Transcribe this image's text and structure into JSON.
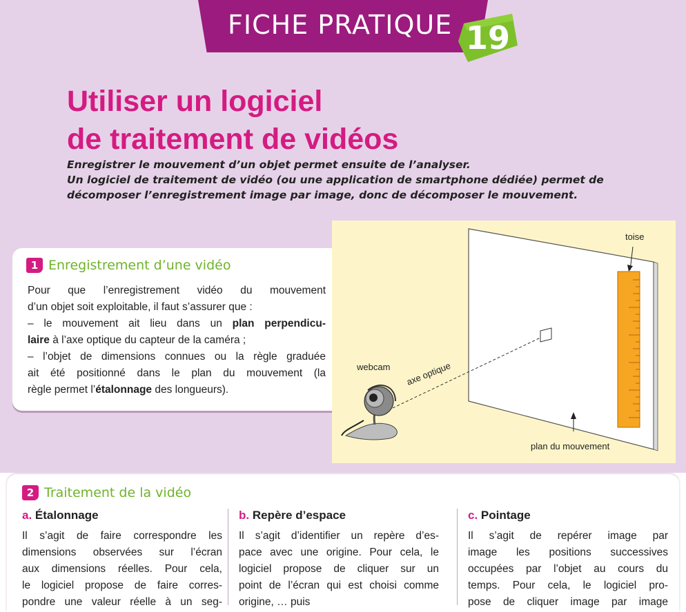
{
  "header": {
    "banner_title": "FICHE PRATIQUE",
    "number": "19",
    "banner_color": "#9c1b7e",
    "badge_color": "#7dc02c"
  },
  "title": {
    "line1": "Utiliser un logiciel",
    "line2": "de traitement de vidéos",
    "color": "#d41b82"
  },
  "intro": {
    "line1": "Enregistrer le mouvement d’un objet permet ensuite de l’analyser.",
    "line2": "Un logiciel de traitement de vidéo (ou une application de smartphone dédiée) permet de",
    "line3": "décomposer l’enregistrement image par image, donc de décomposer le mouvement."
  },
  "section1": {
    "number": "1",
    "title": "Enregistrement d’une vidéo",
    "lines": {
      "l1": "Pour que l’enregistrement vidéo du mouvement",
      "l2": "d’un objet soit exploitable, il faut s’assurer que :",
      "l3a": "– le mouvement ait lieu dans un ",
      "l3b": "plan perpendicu-",
      "l4a": "laire",
      "l4b": " à l’axe optique du capteur de la caméra ;",
      "l5": "– l’objet de dimensions connues ou la règle graduée",
      "l6": "ait été positionné dans le plan du mouvement (la",
      "l7a": "règle permet l’",
      "l7b": "étalonnage",
      "l7c": " des longueurs)."
    }
  },
  "diagram": {
    "label_toise": "toise",
    "label_webcam": "webcam",
    "label_axe": "axe optique",
    "label_plan": "plan du mouvement"
  },
  "section2": {
    "number": "2",
    "title": "Traitement de la vidéo",
    "columns": [
      {
        "letter": "a.",
        "heading": "Étalonnage",
        "lines": [
          "Il s’agit de faire correspondre les",
          "dimensions observées sur l’écran",
          "aux dimensions réelles. Pour cela,",
          "le logiciel propose de faire corres-",
          "pondre une valeur réelle à un seg-"
        ]
      },
      {
        "letter": "b.",
        "heading": "Repère d’espace",
        "lines": [
          "Il s’agit d’identifier un repère d’es-",
          "pace avec une origine. Pour cela, le",
          "logiciel propose de cliquer sur un",
          "point de l’écran qui est choisi comme",
          "origine, … puis"
        ]
      },
      {
        "letter": "c.",
        "heading": "Pointage",
        "lines": [
          "Il s’agit de repérer image par",
          "image les positions successives",
          "occupées par l’objet au cours du",
          "temps. Pour cela, le logiciel pro-",
          "pose de cliquer image par image"
        ]
      }
    ]
  }
}
